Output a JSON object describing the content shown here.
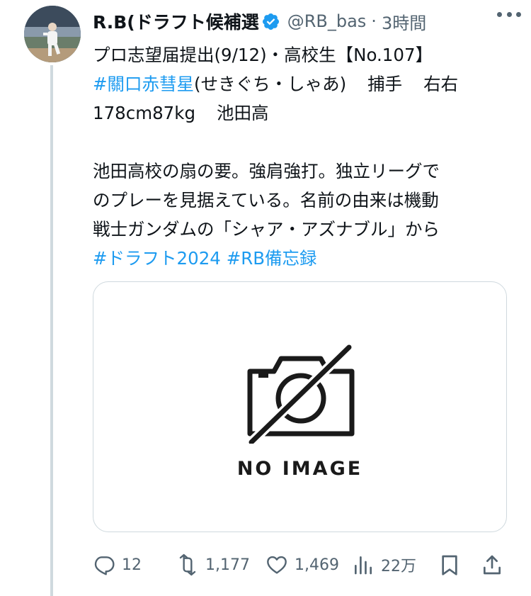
{
  "author": {
    "display_name": "R.B(ドラフト候補選",
    "handle": "@RB_bas",
    "separator": "·",
    "time": "3時間"
  },
  "tweet": {
    "line1": "プロ志望届提出(9/12)・高校生【No.107】",
    "line2_tag": "#關口赤彗星",
    "line2_rest": "(せきぐち・しゃあ)",
    "line2_pos": "捕手",
    "line2_hand": "右右",
    "line3_size": "178cm87kg",
    "line3_school": "池田高",
    "para2_line1": "池田高校の扇の要。強肩強打。独立リーグで",
    "para2_line2": "のプレーを見据えている。名前の由来は機動",
    "para2_line3": "戦士ガンダムの「シャア・アズナブル」から",
    "hashtag1": "#ドラフト2024",
    "hashtag2": "#RB備忘録"
  },
  "media": {
    "placeholder_text": "NO IMAGE"
  },
  "actions": {
    "replies": "12",
    "retweets": "1,177",
    "likes": "1,469",
    "views": "22万"
  },
  "colors": {
    "link": "#1d9bf0",
    "muted": "#536471",
    "verified": "#1d9bf0",
    "border": "#cfd9de"
  },
  "icons": [
    "verified-badge-icon",
    "more-icon",
    "reply-icon",
    "retweet-icon",
    "like-icon",
    "views-icon",
    "bookmark-icon",
    "share-icon",
    "camera-off-icon"
  ]
}
